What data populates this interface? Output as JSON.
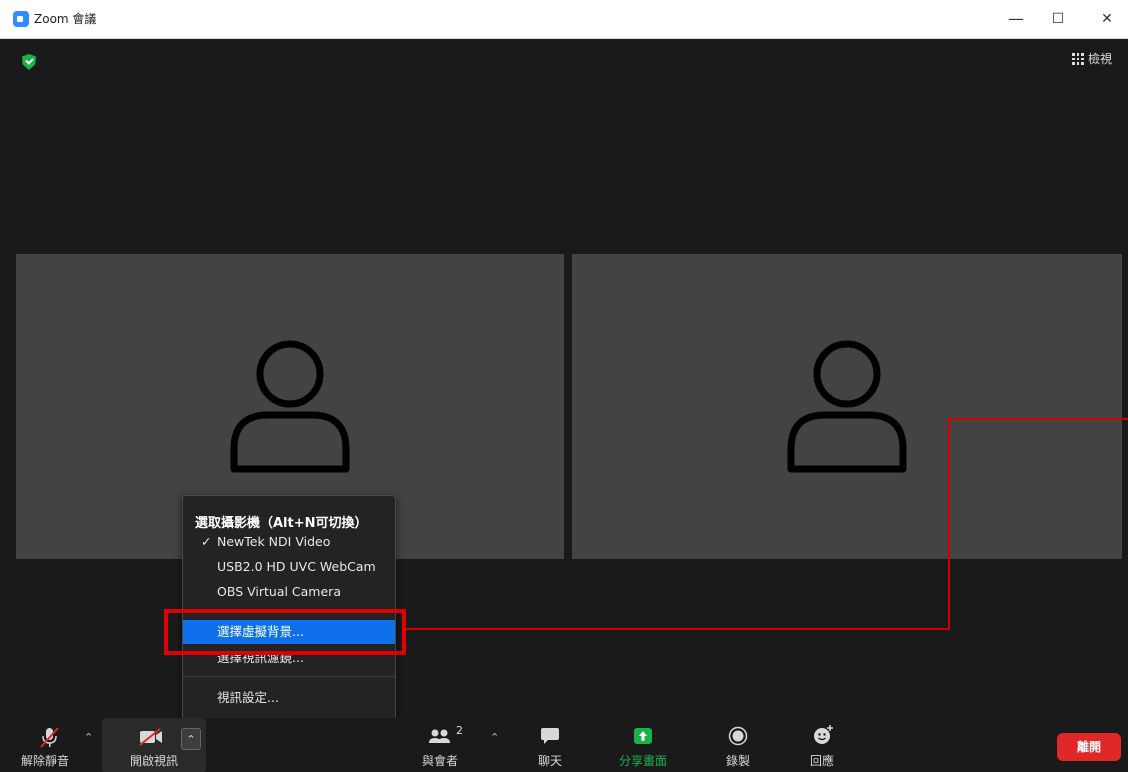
{
  "window": {
    "title": "Zoom 會議",
    "minimize": "—",
    "maximize": "☐",
    "close": "✕"
  },
  "top_right": {
    "view_label": "檢視"
  },
  "menu": {
    "header": "選取攝影機（Alt+N可切換）",
    "cameras": [
      {
        "label": "NewTek NDI Video",
        "checked": "✓"
      },
      {
        "label": "USB2.0 HD UVC WebCam"
      },
      {
        "label": "OBS Virtual Camera"
      }
    ],
    "virtual_bg": "選擇虛擬背景...",
    "video_filter": "選擇視訊濾鏡...",
    "video_settings": "視訊設定..."
  },
  "toolbar": {
    "unmute": "解除靜音",
    "start_video": "開啟視訊",
    "participants": "與會者",
    "participants_count": "2",
    "chat": "聊天",
    "share_screen": "分享畫面",
    "record": "錄製",
    "reactions": "回應",
    "leave": "離開"
  },
  "colors": {
    "accent": "#0e71eb",
    "share_green": "#19b24b",
    "leave_red": "#e02828",
    "annotation_red": "#e00000"
  }
}
